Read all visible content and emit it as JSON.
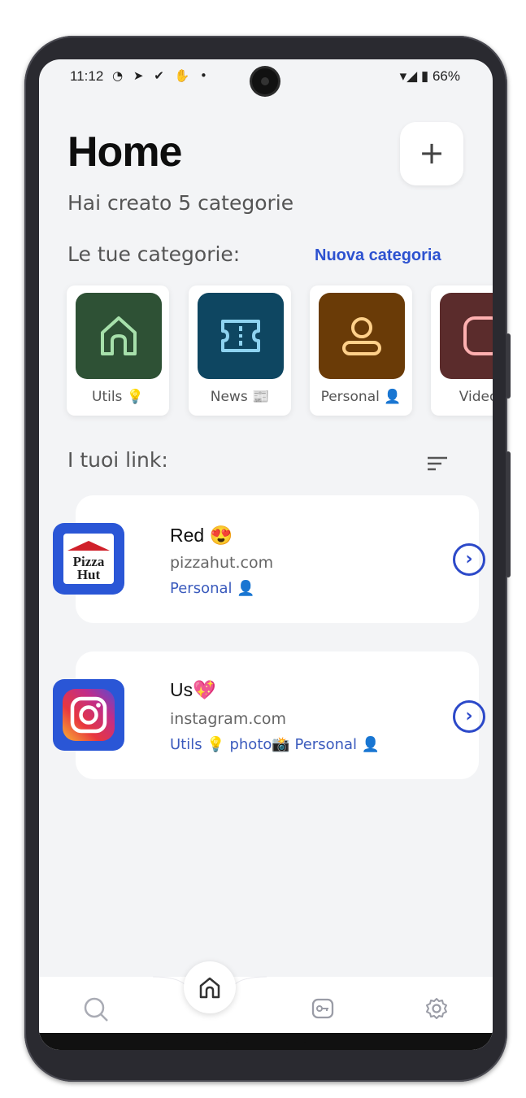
{
  "status_bar": {
    "time": "11:12",
    "icons": "◔ ➤ ✔ ✋ •",
    "right": "▾◢ ▮ 66%"
  },
  "header": {
    "title": "Home",
    "subtitle": "Hai creato 5 categorie",
    "add_label": "+"
  },
  "categories_section": {
    "title": "Le tue categorie:",
    "new_label": "Nuova categoria"
  },
  "categories": [
    {
      "label": "Utils 💡",
      "color": "#2e5135",
      "icon": "home-icon"
    },
    {
      "label": "News 📰",
      "color": "#0e4661",
      "icon": "ticket-icon"
    },
    {
      "label": "Personal 👤",
      "color": "#6a3b07",
      "icon": "person-icon"
    },
    {
      "label": "Videos",
      "color": "#5b2c2c",
      "icon": "square-icon"
    }
  ],
  "links_section": {
    "title": "I tuoi link:"
  },
  "links": [
    {
      "name": "Red 😍",
      "url": "pizzahut.com",
      "tags": "Personal 👤",
      "logo": "pizzahut-logo"
    },
    {
      "name": "Us💖",
      "url": "instagram.com",
      "tags": "Utils 💡   photo📸   Personal 👤",
      "logo": "instagram-logo"
    }
  ],
  "logo_text": {
    "pizza": "Pizza",
    "hut": "Hut"
  },
  "nav": {
    "items": [
      "search-icon",
      "home-icon",
      "key-icon",
      "gear-icon"
    ]
  }
}
